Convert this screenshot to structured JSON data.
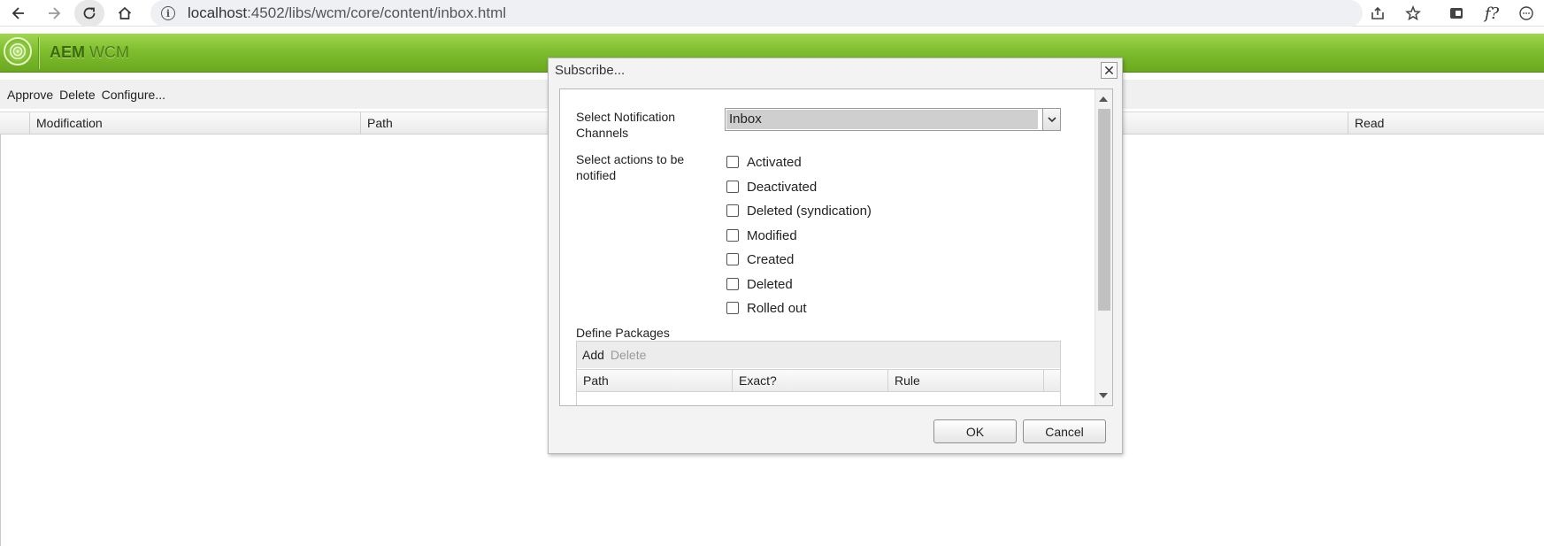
{
  "browser": {
    "url_host": "localhost",
    "url_path": ":4502/libs/wcm/core/content/inbox.html",
    "profile_label": "f?"
  },
  "app": {
    "brand_bold": "AEM",
    "brand_light": "WCM"
  },
  "toolbar": {
    "approve": "Approve",
    "delete": "Delete",
    "configure": "Configure..."
  },
  "grid": {
    "columns": [
      "Modification",
      "Path",
      "Read"
    ]
  },
  "dialog": {
    "title": "Subscribe...",
    "channels_label": "Select Notification Channels",
    "channel_value": "Inbox",
    "actions_label": "Select actions to be notified",
    "actions": [
      {
        "label": "Activated",
        "checked": false
      },
      {
        "label": "Deactivated",
        "checked": false
      },
      {
        "label": "Deleted (syndication)",
        "checked": false
      },
      {
        "label": "Modified",
        "checked": false
      },
      {
        "label": "Created",
        "checked": false
      },
      {
        "label": "Deleted",
        "checked": false
      },
      {
        "label": "Rolled out",
        "checked": false
      }
    ],
    "packages_label": "Define Packages",
    "packages_add": "Add",
    "packages_delete": "Delete",
    "packages_columns": [
      "Path",
      "Exact?",
      "Rule"
    ],
    "ok": "OK",
    "cancel": "Cancel"
  },
  "colors": {
    "header_green": "#7fbe2e",
    "dialog_bg": "#f3f3f3"
  }
}
